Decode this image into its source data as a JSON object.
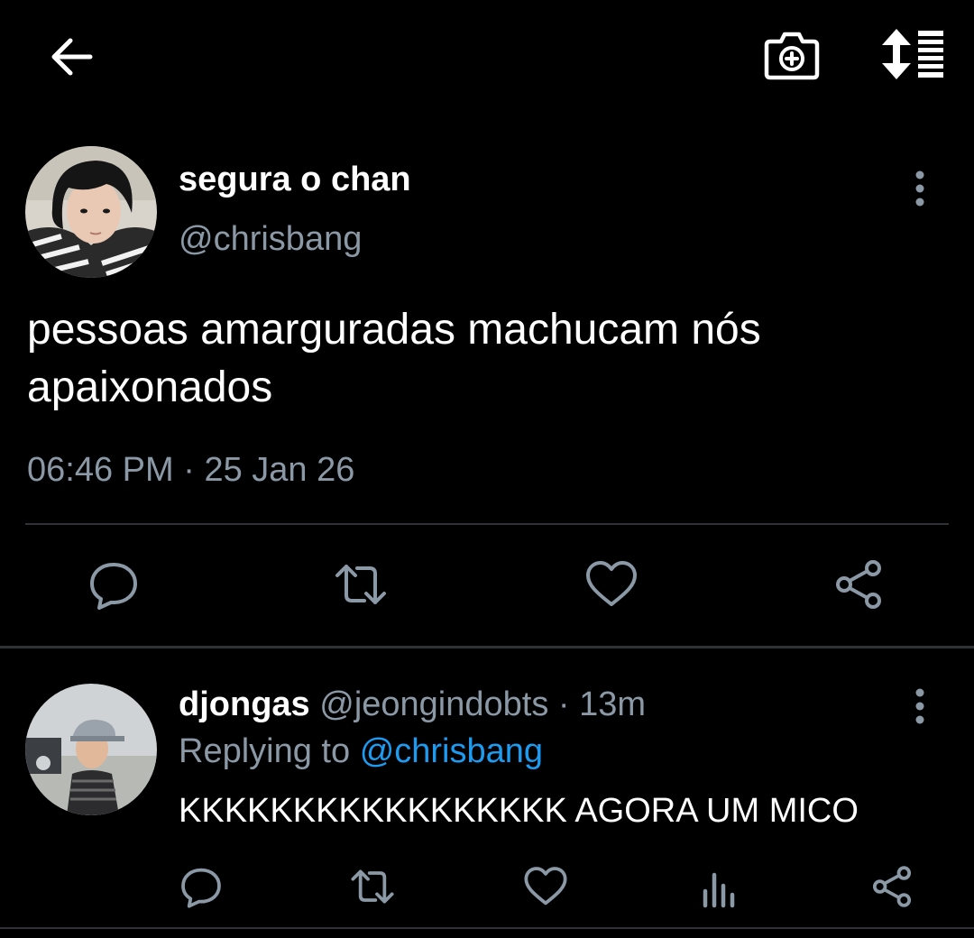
{
  "topbar": {
    "back_icon": "arrow-left-icon",
    "camera_icon": "camera-plus-icon",
    "sort_icon": "sort-toggle-icon"
  },
  "main_tweet": {
    "display_name": "segura o chan",
    "handle": "@chrisbang",
    "text": "pessoas amarguradas machucam nós apaixonados",
    "time": "06:46 PM",
    "separator": "·",
    "date": "25 Jan 26",
    "actions": [
      "reply-icon",
      "retweet-icon",
      "like-icon",
      "share-icon"
    ]
  },
  "reply_tweet": {
    "display_name": "djongas",
    "handle": "@jeongindobts",
    "separator": "·",
    "age": "13m",
    "replying_prefix": "Replying to",
    "replying_to": "@chrisbang",
    "text": "KKKKKKKKKKKKKKKKK AGORA UM MICO",
    "actions": [
      "reply-icon",
      "retweet-icon",
      "like-icon",
      "stats-icon",
      "share-icon"
    ]
  },
  "colors": {
    "background": "#000000",
    "primary_text": "#ffffff",
    "secondary_text": "#8b98a5",
    "accent": "#1d9bf0",
    "divider": "#2f3336"
  }
}
